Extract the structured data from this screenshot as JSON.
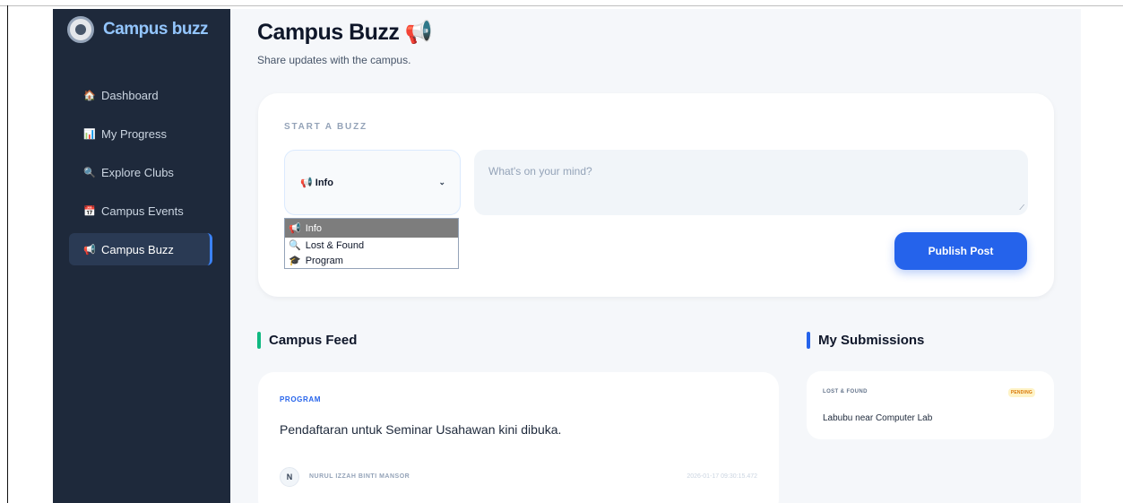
{
  "brand": {
    "name": "Campus buzz",
    "logo_icon": "university-seal-icon"
  },
  "sidebar": {
    "items": [
      {
        "icon": "🏠",
        "label": "Dashboard",
        "active": false
      },
      {
        "icon": "📊",
        "label": "My Progress",
        "active": false
      },
      {
        "icon": "🔍",
        "label": "Explore Clubs",
        "active": false
      },
      {
        "icon": "📅",
        "label": "Campus Events",
        "active": false
      },
      {
        "icon": "📢",
        "label": "Campus Buzz",
        "active": true
      }
    ]
  },
  "header": {
    "title": "Campus Buzz",
    "title_icon": "📢",
    "subtitle": "Share updates with the campus."
  },
  "composer": {
    "section_label": "START A BUZZ",
    "category_select": {
      "selected_icon": "📢",
      "selected_label": "Info"
    },
    "options": [
      {
        "icon": "📢",
        "label": "Info",
        "highlighted": true
      },
      {
        "icon": "🔍",
        "label": "Lost & Found",
        "highlighted": false
      },
      {
        "icon": "🎓",
        "label": "Program",
        "highlighted": false
      }
    ],
    "textarea_placeholder": "What's on your mind?",
    "publish_label": "Publish Post"
  },
  "feed": {
    "title": "Campus Feed",
    "accent": "#10b981",
    "posts": [
      {
        "category": "PROGRAM",
        "text": "Pendaftaran untuk Seminar Usahawan kini dibuka.",
        "author_initial": "N",
        "author": "NURUL IZZAH BINTI MANSOR",
        "timestamp": "2026-01-17 09:30:15.472"
      }
    ]
  },
  "submissions": {
    "title": "My Submissions",
    "accent": "#2563eb",
    "items": [
      {
        "category": "LOST & FOUND",
        "status": "PENDING",
        "text": "Labubu near Computer Lab"
      }
    ]
  },
  "colors": {
    "sidebar_bg": "#1e293b",
    "primary": "#2563eb",
    "brand_text": "#93c5fd"
  }
}
